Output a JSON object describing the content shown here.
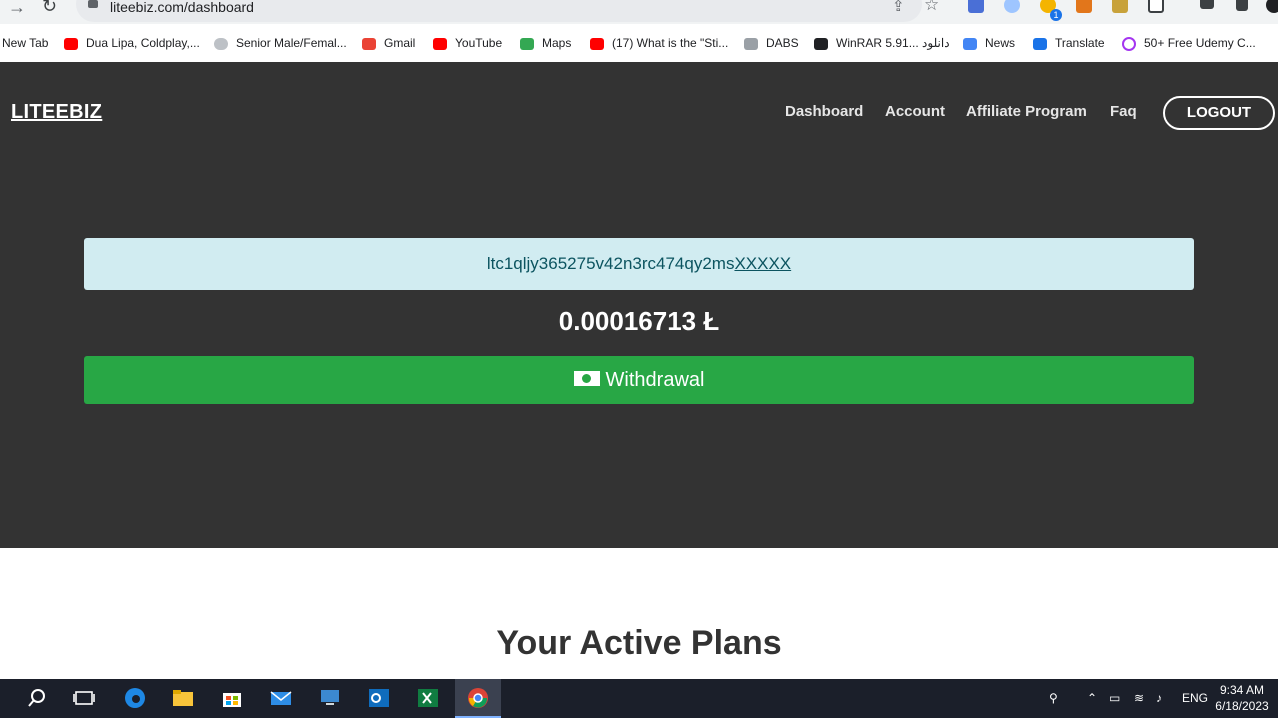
{
  "browser": {
    "url": "liteebiz.com/dashboard",
    "bookmarks": [
      "New Tab",
      "Dua Lipa, Coldplay,...",
      "Senior Male/Femal...",
      "Gmail",
      "YouTube",
      "Maps",
      "(17) What is the \"Sti...",
      "DABS",
      "WinRAR 5.91... دانلود",
      "News",
      "Translate",
      "50+ Free Udemy C..."
    ],
    "extension_badge": "1"
  },
  "site": {
    "logo": "LITEEBIZ",
    "nav": [
      "Dashboard",
      "Account",
      "Affiliate Program",
      "Faq"
    ],
    "logout_label": "LOGOUT"
  },
  "wallet": {
    "address": "ltc1qljy365275v42n3rc474qy2ms",
    "address_masked": "XXXXX",
    "balance": "0.00016713 Ł",
    "withdraw_label": "Withdrawal"
  },
  "plans": {
    "title": "Your Active Plans"
  },
  "taskbar": {
    "language": "ENG",
    "time": "9:34 AM",
    "date": "6/18/2023"
  },
  "colors": {
    "header_bg": "#333333",
    "address_bg": "#d1ecf1",
    "address_text": "#0c5460",
    "withdraw_bg": "#28a745"
  }
}
